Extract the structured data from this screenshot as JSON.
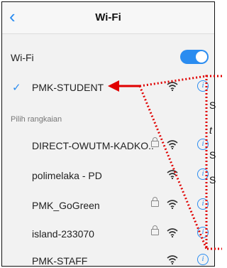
{
  "header": {
    "title": "Wi-Fi",
    "back_icon": "chevron-left-icon"
  },
  "wifi_toggle": {
    "label": "Wi-Fi",
    "state": "on",
    "accent": "#2a8cf0"
  },
  "current_network": {
    "name": "PMK-STUDENT",
    "connected": true
  },
  "section": {
    "label": "Pilih rangkaian"
  },
  "networks": [
    {
      "name": "DIRECT-OWUTM-KADKO..",
      "secured": true
    },
    {
      "name": "polimelaka - PD",
      "secured": false
    },
    {
      "name": "PMK_GoGreen",
      "secured": true
    },
    {
      "name": "island-233070",
      "secured": true
    },
    {
      "name": "PMK-STAFF",
      "secured": false
    }
  ],
  "annotation": {
    "color": "#e00000",
    "text_fragments": [
      "S",
      "t",
      "S",
      "S"
    ]
  }
}
